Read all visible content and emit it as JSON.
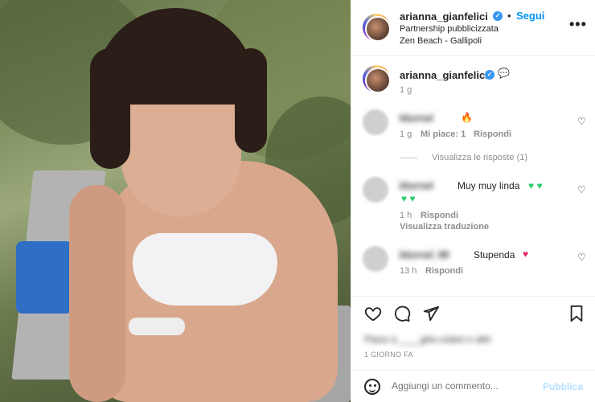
{
  "post": {
    "username": "arianna_gianfelici",
    "follow_label": "Segui",
    "dot": "•",
    "partnership": "Partnership pubblicizzata",
    "location": "Zen Beach - Gallipoli",
    "more_icon": "more-options-icon"
  },
  "caption": {
    "username": "arianna_gianfelici",
    "time": "1 g"
  },
  "comments": [
    {
      "username": "blurred",
      "text": "",
      "emoji": "🔥",
      "time": "1 g",
      "likes": "Mi piace: 1",
      "reply": "Rispondi",
      "view_replies": "Visualizza le risposte (1)"
    },
    {
      "username": "blurred",
      "text": "Muy muy linda",
      "emoji_line1": "💚 💚",
      "emoji_line2": "💚 💚",
      "time": "1 h",
      "reply": "Rispondi",
      "translate": "Visualizza traduzione"
    },
    {
      "username": "blurred_99",
      "text": "Stupenda",
      "emoji": "❤️",
      "time": "13 h",
      "reply": "Rispondi"
    }
  ],
  "likes_blurred": "Piace a ____ghe.colani e altri",
  "date": "1 GIORNO FA",
  "composer": {
    "placeholder": "Aggiungi un commento...",
    "publish": "Pubblica"
  },
  "colors": {
    "accent": "#0095f6",
    "verified": "#3897f0",
    "publish_disabled": "#b2dffc",
    "green_heart": "#2ecc71",
    "red_heart": "#e0245e",
    "orange_flame": "#f39c12"
  }
}
